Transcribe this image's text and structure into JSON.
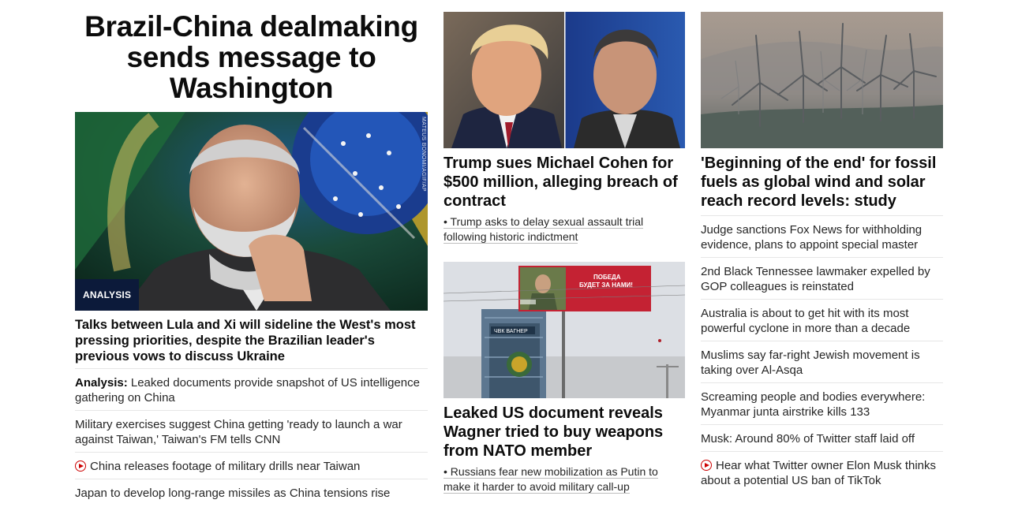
{
  "main": {
    "headline": "Brazil-China dealmaking sends message to Washington",
    "badge": "ANALYSIS",
    "photo_credit": "MATEUS BONOMI/AGIF/AP",
    "subheadline": "Talks between Lula and Xi will sideline the West's most pressing priorities, despite the Brazilian leader's previous vows to discuss Ukraine",
    "related": [
      {
        "prefix": "Analysis:",
        "text": "Leaked documents provide snapshot of US intelligence gathering on China"
      },
      {
        "prefix": "",
        "text": "Military exercises suggest China getting 'ready to launch a war against Taiwan,' Taiwan's FM tells CNN"
      },
      {
        "prefix": "",
        "text": "China releases footage of military drills near Taiwan",
        "video": true
      },
      {
        "prefix": "",
        "text": "Japan to develop long-range missiles as China tensions rise"
      }
    ]
  },
  "middle": {
    "story1": {
      "headline": "Trump sues Michael Cohen for $500 million, alleging breach of contract",
      "bullet": "• Trump asks to delay sexual assault trial following historic indictment"
    },
    "story2": {
      "billboard_line1": "ПОБЕДА",
      "billboard_line2": "БУДЕТ ЗА НАМИ!",
      "building_sign": "ЧВК ВАГНЕР",
      "headline": "Leaked US document reveals Wagner tried to buy weapons from NATO member",
      "bullet": "• Russians fear new mobilization as Putin to make it harder to avoid military call-up"
    }
  },
  "right": {
    "headline": "'Beginning of the end' for fossil fuels as global wind and solar reach record levels: study",
    "list": [
      {
        "text": "Judge sanctions Fox News for withholding evidence, plans to appoint special master"
      },
      {
        "text": "2nd Black Tennessee lawmaker expelled by GOP colleagues is reinstated"
      },
      {
        "text": "Australia is about to get hit with its most powerful cyclone in more than a decade"
      },
      {
        "text": "Muslims say far-right Jewish movement is taking over Al-Asqa"
      },
      {
        "text": "Screaming people and bodies everywhere: Myanmar junta airstrike kills 133"
      },
      {
        "text": "Musk: Around 80% of Twitter staff laid off"
      },
      {
        "text": "Hear what Twitter owner Elon Musk thinks about a potential US ban of TikTok",
        "video": true
      }
    ]
  },
  "colors": {
    "text": "#0c0c0c",
    "divider": "#e6e6e6",
    "video_red": "#cc0000",
    "badge_bg": "#0c1a3a"
  }
}
